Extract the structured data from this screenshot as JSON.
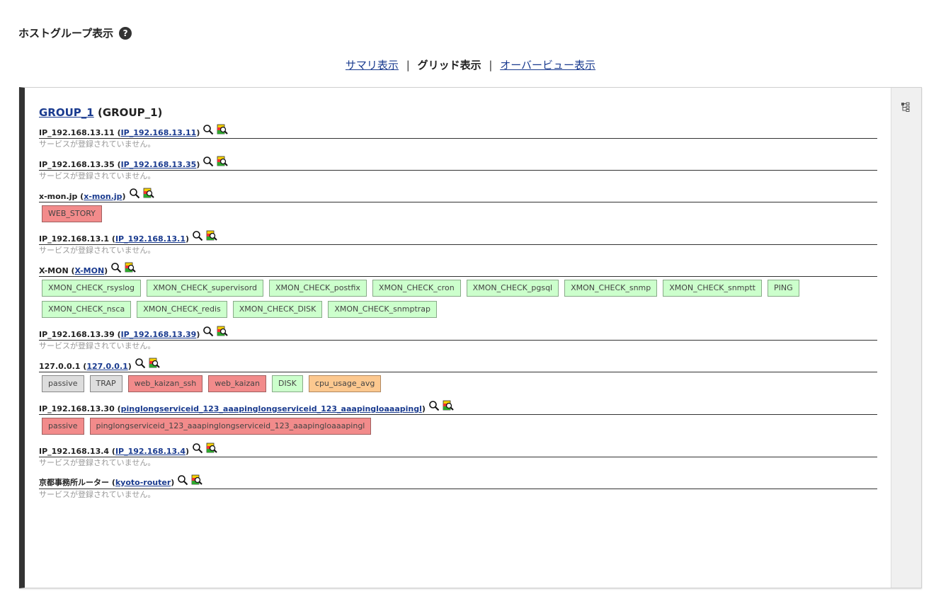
{
  "page": {
    "title": "ホストグループ表示",
    "help": "?"
  },
  "tabs": {
    "summary": "サマリ表示",
    "separator": "|",
    "grid": "グリッド表示",
    "overview": "オーバービュー表示"
  },
  "group": {
    "link": "GROUP_1",
    "alias": "(GROUP_1)"
  },
  "hosts": [
    {
      "name": "IP_192.168.13.11",
      "link": "IP_192.168.13.11",
      "empty": "サービスが登録されていません。",
      "services": []
    },
    {
      "name": "IP_192.168.13.35",
      "link": "IP_192.168.13.35",
      "empty": "サービスが登録されていません。",
      "services": []
    },
    {
      "name": "x-mon.jp",
      "link": "x-mon.jp",
      "services": [
        {
          "label": "WEB_STORY",
          "state": "crit"
        }
      ]
    },
    {
      "name": "IP_192.168.13.1",
      "link": "IP_192.168.13.1",
      "empty": "サービスが登録されていません。",
      "services": []
    },
    {
      "name": "X-MON",
      "link": "X-MON",
      "services": [
        {
          "label": "XMON_CHECK_rsyslog",
          "state": "ok"
        },
        {
          "label": "XMON_CHECK_supervisord",
          "state": "ok"
        },
        {
          "label": "XMON_CHECK_postfix",
          "state": "ok"
        },
        {
          "label": "XMON_CHECK_cron",
          "state": "ok"
        },
        {
          "label": "XMON_CHECK_pgsql",
          "state": "ok"
        },
        {
          "label": "XMON_CHECK_snmp",
          "state": "ok"
        },
        {
          "label": "XMON_CHECK_snmptt",
          "state": "ok"
        },
        {
          "label": "PING",
          "state": "ok"
        },
        {
          "label": "XMON_CHECK_nsca",
          "state": "ok"
        },
        {
          "label": "XMON_CHECK_redis",
          "state": "ok"
        },
        {
          "label": "XMON_CHECK_DISK",
          "state": "ok"
        },
        {
          "label": "XMON_CHECK_snmptrap",
          "state": "ok"
        }
      ]
    },
    {
      "name": "IP_192.168.13.39",
      "link": "IP_192.168.13.39",
      "empty": "サービスが登録されていません。",
      "services": []
    },
    {
      "name": "127.0.0.1",
      "link": "127.0.0.1",
      "services": [
        {
          "label": "passive",
          "state": "unk"
        },
        {
          "label": "TRAP",
          "state": "unk"
        },
        {
          "label": "web_kaizan_ssh",
          "state": "crit"
        },
        {
          "label": "web_kaizan",
          "state": "crit"
        },
        {
          "label": "DISK",
          "state": "ok"
        },
        {
          "label": "cpu_usage_avg",
          "state": "warn"
        }
      ]
    },
    {
      "name": "IP_192.168.13.30",
      "link": "pinglongserviceid_123_aaapinglongserviceid_123_aaapingloaaapingl",
      "services": [
        {
          "label": "passive",
          "state": "crit"
        },
        {
          "label": "pinglongserviceid_123_aaapinglongserviceid_123_aaapingloaaapingl",
          "state": "crit"
        }
      ]
    },
    {
      "name": "IP_192.168.13.4",
      "link": "IP_192.168.13.4",
      "empty": "サービスが登録されていません。",
      "services": []
    },
    {
      "name": "京都事務所ルーター",
      "link": "kyoto-router",
      "empty": "サービスが登録されていません。",
      "services": []
    }
  ],
  "icons": {
    "search": "magnifier-icon",
    "host_detail": "host-detail-icon",
    "tree": "tree-view-icon"
  },
  "colors": {
    "ok": "#ccffcc",
    "critical": "#f28b8b",
    "unknown": "#dddddd",
    "warning": "#fcc88f",
    "link": "#1a3b8f"
  }
}
